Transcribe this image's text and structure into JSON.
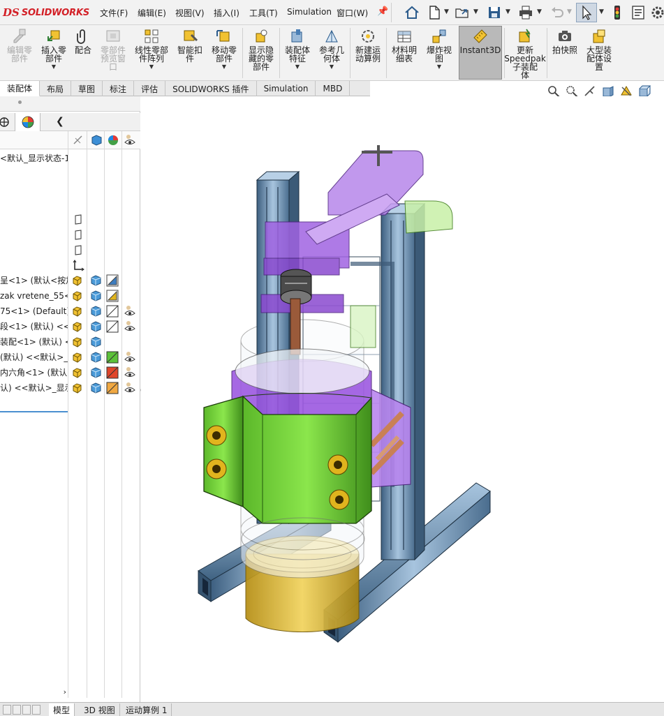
{
  "app": {
    "brand": "SOLIDWORKS",
    "brand_mark": "DS"
  },
  "menu": [
    "文件(F)",
    "编辑(E)",
    "视图(V)",
    "插入(I)",
    "工具(T)",
    "Simulation",
    "窗口(W)"
  ],
  "command_manager": [
    {
      "id": "edit-component",
      "label": "编辑零\n部件",
      "enabled": false,
      "dropdown": false,
      "icon": "edit-component-icon"
    },
    {
      "id": "insert-components",
      "label": "插入零\n部件",
      "enabled": true,
      "dropdown": true,
      "icon": "insert-components-icon"
    },
    {
      "id": "mate",
      "label": "配合",
      "enabled": true,
      "dropdown": false,
      "icon": "mate-icon"
    },
    {
      "id": "component-preview",
      "label": "零部件\n预览窗\n口",
      "enabled": false,
      "dropdown": false,
      "icon": "preview-window-icon"
    },
    {
      "id": "linear-pattern",
      "label": "线性零部\n件阵列",
      "enabled": true,
      "dropdown": true,
      "icon": "linear-pattern-icon"
    },
    {
      "id": "smart-fasteners",
      "label": "智能扣\n件",
      "enabled": true,
      "dropdown": false,
      "icon": "smart-fasteners-icon"
    },
    {
      "id": "move-component",
      "label": "移动零\n部件",
      "enabled": true,
      "dropdown": true,
      "icon": "move-component-icon"
    },
    {
      "id": "show-hidden",
      "label": "显示隐\n藏的零\n部件",
      "enabled": true,
      "dropdown": false,
      "icon": "show-hidden-icon"
    },
    {
      "id": "assembly-features",
      "label": "装配体\n特征",
      "enabled": true,
      "dropdown": true,
      "icon": "assembly-features-icon"
    },
    {
      "id": "reference-geometry",
      "label": "参考几\n何体",
      "enabled": true,
      "dropdown": true,
      "icon": "reference-geometry-icon"
    },
    {
      "id": "new-motion-study",
      "label": "新建运\n动算例",
      "enabled": true,
      "dropdown": false,
      "icon": "motion-study-icon"
    },
    {
      "id": "bom",
      "label": "材料明\n细表",
      "enabled": true,
      "dropdown": false,
      "icon": "bom-icon"
    },
    {
      "id": "exploded-view",
      "label": "爆炸视\n图",
      "enabled": true,
      "dropdown": true,
      "icon": "exploded-view-icon"
    },
    {
      "id": "instant3d",
      "label": "Instant3D",
      "enabled": true,
      "dropdown": false,
      "active": true,
      "icon": "instant3d-icon"
    },
    {
      "id": "speedpak",
      "label": "更新\nSpeedpak\n子装配\n体",
      "enabled": true,
      "dropdown": false,
      "icon": "speedpak-icon"
    },
    {
      "id": "snapshot",
      "label": "拍快照",
      "enabled": true,
      "dropdown": false,
      "icon": "camera-icon"
    },
    {
      "id": "large-assembly",
      "label": "大型装\n配体设\n置",
      "enabled": true,
      "dropdown": false,
      "icon": "large-assembly-icon"
    }
  ],
  "tabs": [
    "装配体",
    "布局",
    "草图",
    "标注",
    "评估",
    "SOLIDWORKS 插件",
    "Simulation",
    "MBD"
  ],
  "active_tab": "装配体",
  "tree": {
    "top_item": "<默认_显示状态-1",
    "rows": [
      {
        "text": "呈<1> (默认<按加工",
        "appearance": "blue-triangle"
      },
      {
        "text": "zak vretene_55<1",
        "appearance": "yellow-triangle"
      },
      {
        "text": "75<1> (Default)",
        "appearance": "white-square"
      },
      {
        "text": "段<1> (默认) <<默",
        "appearance": "white-square"
      },
      {
        "text": "装配<1> (默认) <<默",
        "appearance": "none"
      },
      {
        "text": "(默认) <<默认>_显",
        "appearance": "green-square"
      },
      {
        "text": "内六角<1> (默认)",
        "appearance": "red-square"
      },
      {
        "text": "认) <<默认>_显示状",
        "appearance": "orange-square"
      }
    ],
    "eye_rows": [
      2,
      3,
      5,
      6,
      7
    ]
  },
  "bottom_tabs": [
    "模型",
    "3D 视图",
    "运动算例 1"
  ],
  "active_bottom_tab": "模型",
  "colors": {
    "aluminum_profile": "#7fa3c4",
    "purple_parts": "#a25ee0",
    "green_clamp": "#7ddc3b",
    "gold_cup": "#d8b52a",
    "accent_red": "#d32027"
  }
}
